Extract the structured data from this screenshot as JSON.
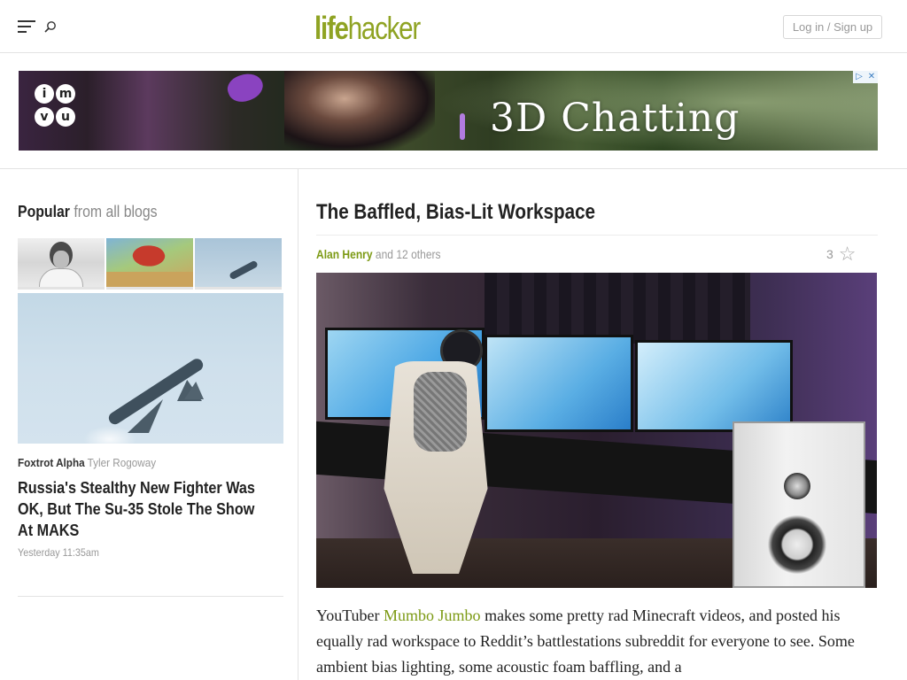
{
  "header": {
    "logo_life": "life",
    "logo_hacker": "hacker",
    "login_label": "Log in / Sign up",
    "menu_icon": "hamburger-menu-icon",
    "search_icon": "search-icon",
    "brand_color": "#8fa323"
  },
  "ad": {
    "logo_text": "imvu",
    "headline": "3D Chatting",
    "badges": [
      "▷",
      "✕"
    ]
  },
  "sidebar": {
    "title_strong": "Popular",
    "title_sub": "from all blogs",
    "featured": {
      "blog": "Foxtrot Alpha",
      "author": "Tyler Rogoway",
      "headline": "Russia's Stealthy New Fighter Was OK, But The Su-35 Stole The Show At MAKS",
      "timestamp": "Yesterday 11:35am"
    }
  },
  "article": {
    "title": "The Baffled, Bias-Lit Workspace",
    "author": "Alan Henry",
    "others": "and 12 others",
    "like_count": "3",
    "star_icon": "star-icon",
    "body_prefix": "YouTuber ",
    "body_link": "Mumbo Jumbo",
    "body_rest": " makes some pretty rad Minecraft videos, and posted his equally rad workspace to Reddit’s battlestations subreddit for everyone to see. Some ambient bias lighting, some acoustic foam baffling, and a",
    "accent_color": "#7c9a14"
  }
}
